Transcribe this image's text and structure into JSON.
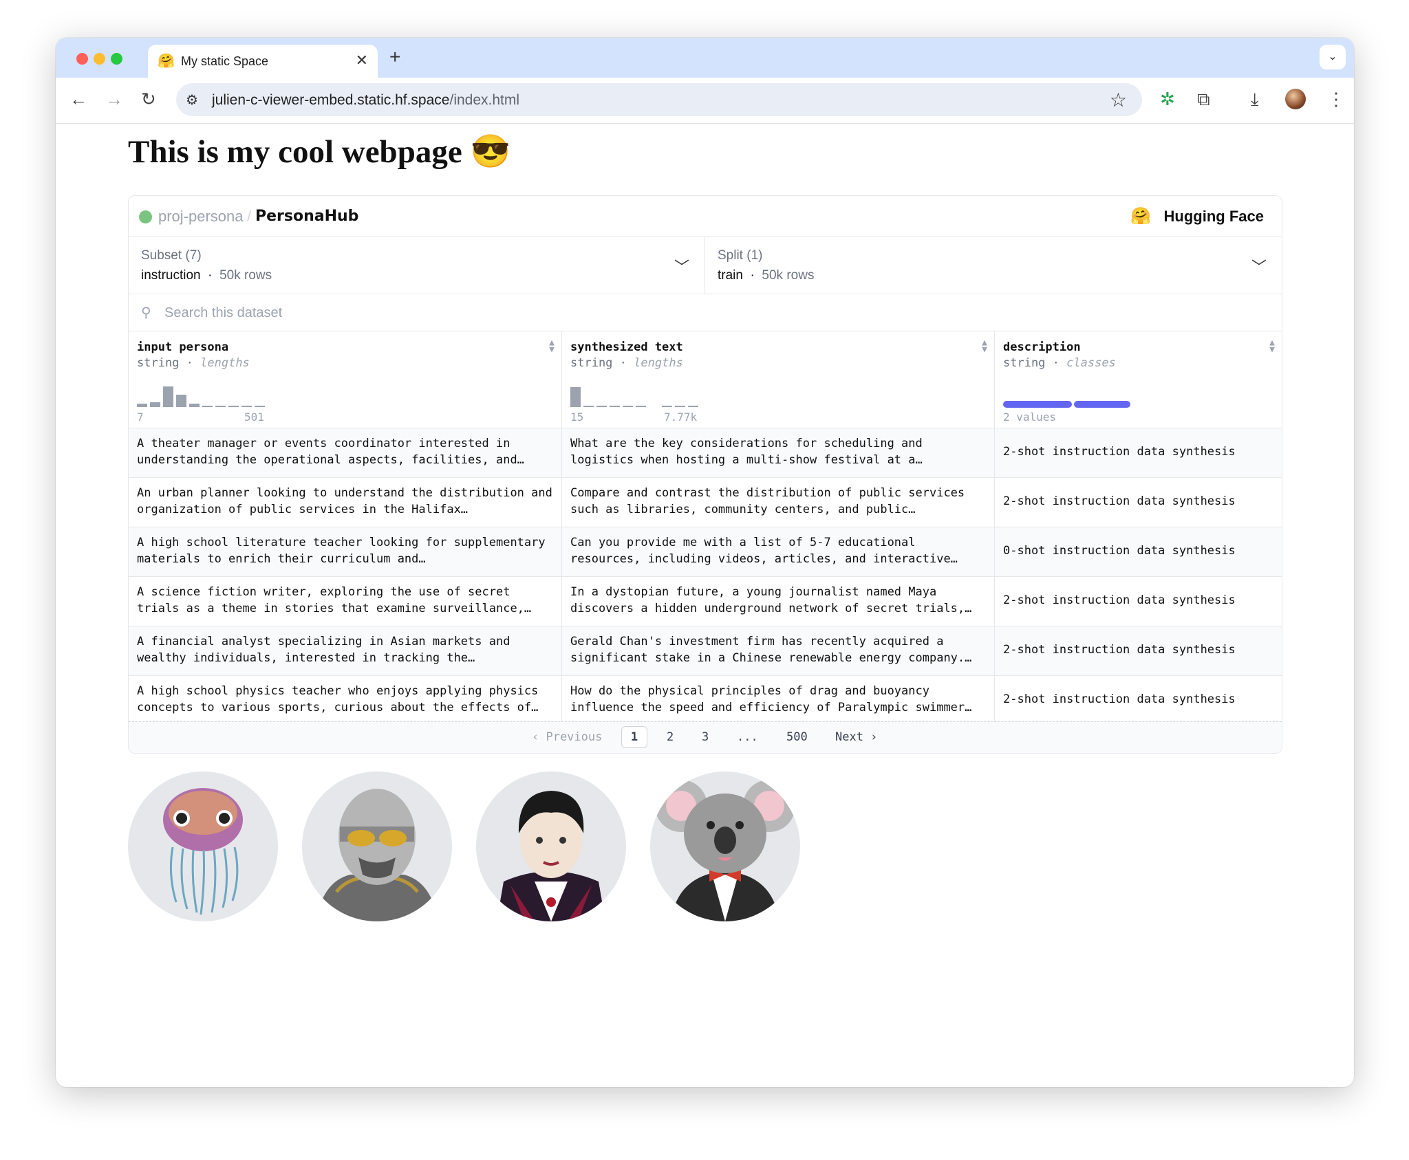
{
  "browser": {
    "tab_title": "My static Space",
    "tab_emoji": "🤗",
    "url_host": "julien-c-viewer-embed.static.hf.space",
    "url_path": "/index.html"
  },
  "page": {
    "heading": "This is my cool webpage 😎"
  },
  "viewer": {
    "org": "proj-persona",
    "separator": "/",
    "dataset": "PersonaHub",
    "brand": "Hugging Face",
    "brand_emoji": "🤗",
    "subset": {
      "label": "Subset (7)",
      "value": "instruction",
      "rows": "50k rows"
    },
    "split": {
      "label": "Split (1)",
      "value": "train",
      "rows": "50k rows"
    },
    "search_placeholder": "Search this dataset",
    "columns": [
      {
        "name": "input persona",
        "type": "string",
        "stat": "lengths",
        "min": "7",
        "max": "501"
      },
      {
        "name": "synthesized text",
        "type": "string",
        "stat": "lengths",
        "min": "15",
        "max": "7.77k"
      },
      {
        "name": "description",
        "type": "string",
        "stat": "classes",
        "summary": "2 values"
      }
    ],
    "rows": [
      {
        "persona": "A theater manager or events coordinator interested in understanding the operational aspects, facilities, and…",
        "text": "What are the key considerations for scheduling and logistics when hosting a multi-show festival at a…",
        "description": "2-shot instruction data synthesis"
      },
      {
        "persona": "An urban planner looking to understand the distribution and organization of public services in the Halifax…",
        "text": "Compare and contrast the distribution of public services such as libraries, community centers, and public…",
        "description": "2-shot instruction data synthesis"
      },
      {
        "persona": "A high school literature teacher looking for supplementary materials to enrich their curriculum and…",
        "text": "Can you provide me with a list of 5-7 educational resources, including videos, articles, and interactive…",
        "description": "0-shot instruction data synthesis"
      },
      {
        "persona": "A science fiction writer, exploring the use of secret trials as a theme in stories that examine surveillance,…",
        "text": "In a dystopian future, a young journalist named Maya discovers a hidden underground network of secret trials,…",
        "description": "2-shot instruction data synthesis"
      },
      {
        "persona": "A financial analyst specializing in Asian markets and wealthy individuals, interested in tracking the…",
        "text": "Gerald Chan's investment firm has recently acquired a significant stake in a Chinese renewable energy company.…",
        "description": "2-shot instruction data synthesis"
      },
      {
        "persona": "A high school physics teacher who enjoys applying physics concepts to various sports, curious about the effects of…",
        "text": "How do the physical principles of drag and buoyancy influence the speed and efficiency of Paralympic swimmer…",
        "description": "2-shot instruction data synthesis"
      }
    ],
    "pagination": {
      "previous": "‹ Previous",
      "pages": [
        "1",
        "2",
        "3",
        "...",
        "500"
      ],
      "current": "1",
      "next": "Next ›"
    }
  },
  "histograms": {
    "persona_bins": [
      0.12,
      0.18,
      0.75,
      0.45,
      0.12,
      0.04,
      0.04,
      0.04,
      0.04,
      0.04
    ],
    "text_bins": [
      0.72,
      0.04,
      0.04,
      0.04,
      0.04,
      0.04,
      0,
      0.04,
      0.04,
      0.04
    ],
    "description_classes": [
      0.55,
      0.45
    ]
  },
  "avatars": [
    "jellyfish-avatar",
    "knight-avatar",
    "vampire-avatar",
    "koala-avatar"
  ],
  "colors": {
    "accent": "#6366f1",
    "tabbar": "#d3e3fd",
    "status_dot": "#7ac47f"
  }
}
